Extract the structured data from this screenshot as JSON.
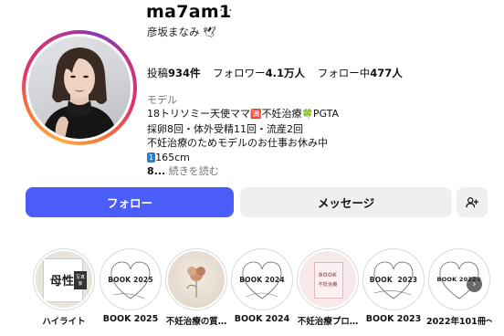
{
  "profile": {
    "username": "ma7am1",
    "more_icon": "more-horizontal-icon",
    "fullname": "彦坂まなみ 🕊",
    "stats": {
      "posts_label": "投稿",
      "posts_value": "934件",
      "followers_label": "フォロワー",
      "followers_value": "4.1万人",
      "following_label": "フォロー中",
      "following_value": "477人"
    },
    "category": "モデル",
    "bio": {
      "line1": "18トリソミー天使ママ",
      "line1_icon": "🈵",
      "line1_rest": "不妊治療",
      "line1_clover": "🍀",
      "line1_end": "PGTA",
      "line2": "採卵8回・体外受精11回・流産2回",
      "line3": "不妊治療のためモデルのお仕事お休み中",
      "line4_badge": "1",
      "line4": "165cm",
      "more_prefix": "8...",
      "more_label": "続きを読む"
    }
  },
  "actions": {
    "follow_label": "フォロー",
    "message_label": "メッセージ",
    "suggest_icon": "add-person-icon"
  },
  "highlights": [
    {
      "label": "ハイライト",
      "cover_text": "母性",
      "cover_sub": "写真家"
    },
    {
      "label": "BOOK 2025",
      "cover_text": "BOOK 2025"
    },
    {
      "label": "不妊治療の質…"
    },
    {
      "label": "BOOK 2024",
      "cover_text": "BOOK 2024"
    },
    {
      "label": "不妊治療プロ…",
      "cover_text": "BOOK",
      "cover_sub": "不妊治療"
    },
    {
      "label": "BOOK 2023",
      "cover_text": "BOOK  2023"
    },
    {
      "label": "2022年101冊〜",
      "cover_text": "BOOK 2022②"
    }
  ],
  "colors": {
    "follow_button": "#4a5df9",
    "secondary_button": "#efefef",
    "muted_text": "#737373"
  }
}
